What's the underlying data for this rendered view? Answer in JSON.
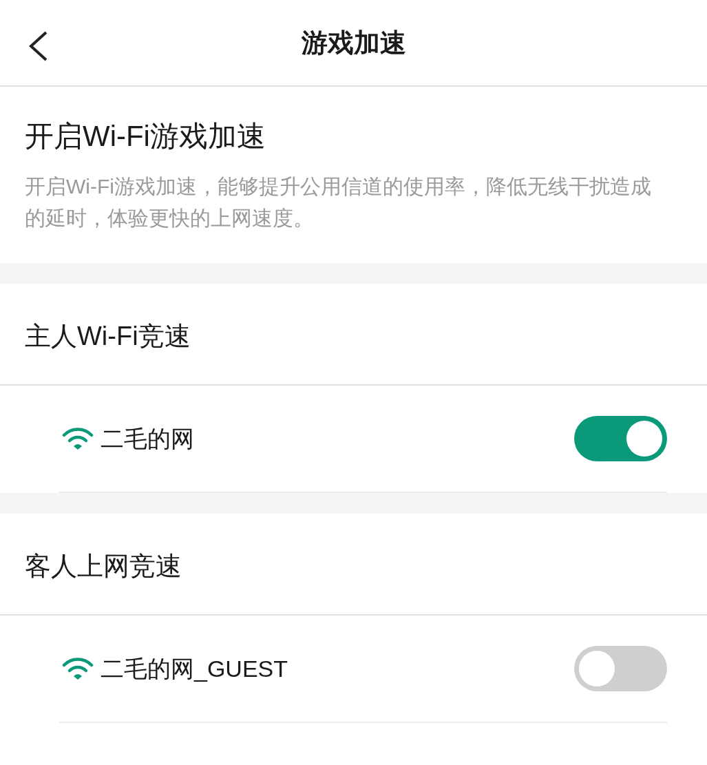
{
  "header": {
    "title": "游戏加速"
  },
  "intro": {
    "title": "开启Wi-Fi游戏加速",
    "description": "开启Wi-Fi游戏加速，能够提升公用信道的使用率，降低无线干扰造成的延时，体验更快的上网速度。"
  },
  "sections": [
    {
      "title": "主人Wi-Fi竞速",
      "networks": [
        {
          "name": "二毛的网",
          "on": true
        }
      ]
    },
    {
      "title": "客人上网竞速",
      "networks": [
        {
          "name": "二毛的网_GUEST",
          "on": false
        }
      ]
    }
  ]
}
